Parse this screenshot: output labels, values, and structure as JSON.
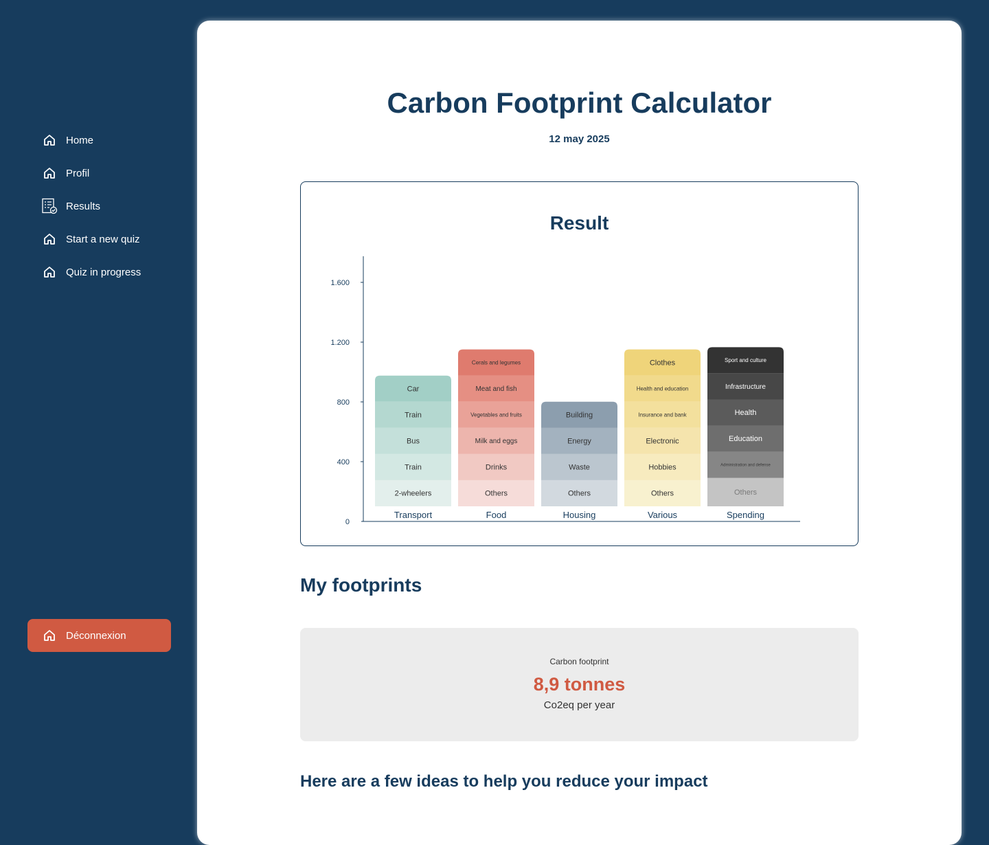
{
  "sidebar": {
    "items": [
      {
        "label": "Home",
        "icon": "home-icon"
      },
      {
        "label": "Profil",
        "icon": "home-icon"
      },
      {
        "label": "Results",
        "icon": "checklist-icon"
      },
      {
        "label": "Start a new quiz",
        "icon": "home-icon"
      },
      {
        "label": "Quiz in progress",
        "icon": "home-icon"
      }
    ],
    "logout": {
      "label": "Déconnexion",
      "icon": "home-icon"
    }
  },
  "header": {
    "title": "Carbon Footprint Calculator",
    "date": "12 may 2025"
  },
  "colors": {
    "sidebar_bg": "#173c5d",
    "accent": "#d05a42",
    "text": "#173c5d"
  },
  "chart_data": {
    "type": "bar",
    "stacked": true,
    "title": "Result",
    "xlabel": "",
    "ylabel": "",
    "ylim": [
      0,
      1800
    ],
    "yticks": [
      0,
      400,
      800,
      1200,
      1600
    ],
    "ytick_labels": [
      "0",
      "400",
      "800",
      "1.200",
      "1.600"
    ],
    "categories": [
      "Transport",
      "Food",
      "Housing",
      "Various",
      "Spending"
    ],
    "groups": [
      {
        "category": "Transport",
        "segments": [
          {
            "label": "2-wheelers",
            "value": 175,
            "color": "#e3efec"
          },
          {
            "label": "Train",
            "value": 175,
            "color": "#d3e8e3"
          },
          {
            "label": "Bus",
            "value": 175,
            "color": "#c4e0da"
          },
          {
            "label": "Train",
            "value": 175,
            "color": "#b4d8d0"
          },
          {
            "label": "Car",
            "value": 175,
            "color": "#a2cfc6"
          }
        ]
      },
      {
        "category": "Food",
        "segments": [
          {
            "label": "Others",
            "value": 175,
            "color": "#f6dcd9"
          },
          {
            "label": "Drinks",
            "value": 175,
            "color": "#f1c9c3"
          },
          {
            "label": "Milk and eggs",
            "value": 175,
            "color": "#edb5ad"
          },
          {
            "label": "Vegetables and fruits",
            "value": 175,
            "color": "#e9a298"
          },
          {
            "label": "Meat and fish",
            "value": 175,
            "color": "#e58f83"
          },
          {
            "label": "Cerals and legumes",
            "value": 175,
            "color": "#df7b6e"
          }
        ]
      },
      {
        "category": "Housing",
        "segments": [
          {
            "label": "Others",
            "value": 175,
            "color": "#d2d9df"
          },
          {
            "label": "Waste",
            "value": 175,
            "color": "#bbc6cf"
          },
          {
            "label": "Energy",
            "value": 175,
            "color": "#a3b2bf"
          },
          {
            "label": "Building",
            "value": 175,
            "color": "#8c9eae"
          }
        ]
      },
      {
        "category": "Various",
        "segments": [
          {
            "label": "Others",
            "value": 175,
            "color": "#f8f1cf"
          },
          {
            "label": "Hobbies",
            "value": 175,
            "color": "#f7ebbf"
          },
          {
            "label": "Electronic",
            "value": 175,
            "color": "#f5e4ad"
          },
          {
            "label": "Insurance and bank",
            "value": 175,
            "color": "#f3e09d"
          },
          {
            "label": "Health and education",
            "value": 175,
            "color": "#f1da8c"
          },
          {
            "label": "Clothes",
            "value": 175,
            "color": "#efd47a"
          }
        ]
      },
      {
        "category": "Spending",
        "segments": [
          {
            "label": "Others",
            "value": 190,
            "color": "#c4c4c4"
          },
          {
            "label": "Administration and defense",
            "value": 175,
            "color": "#868686"
          },
          {
            "label": "Education",
            "value": 175,
            "color": "#6e6e6e"
          },
          {
            "label": "Health",
            "value": 175,
            "color": "#5b5b5b"
          },
          {
            "label": "Infrastructure",
            "value": 175,
            "color": "#474747"
          },
          {
            "label": "Sport and culture",
            "value": 175,
            "color": "#333333"
          }
        ]
      }
    ]
  },
  "footprints": {
    "heading": "My footprints",
    "label": "Carbon footprint",
    "value": "8,9 tonnes",
    "unit": "Co2eq per year"
  },
  "ideas": {
    "heading": "Here are a few ideas to help you reduce your impact"
  }
}
